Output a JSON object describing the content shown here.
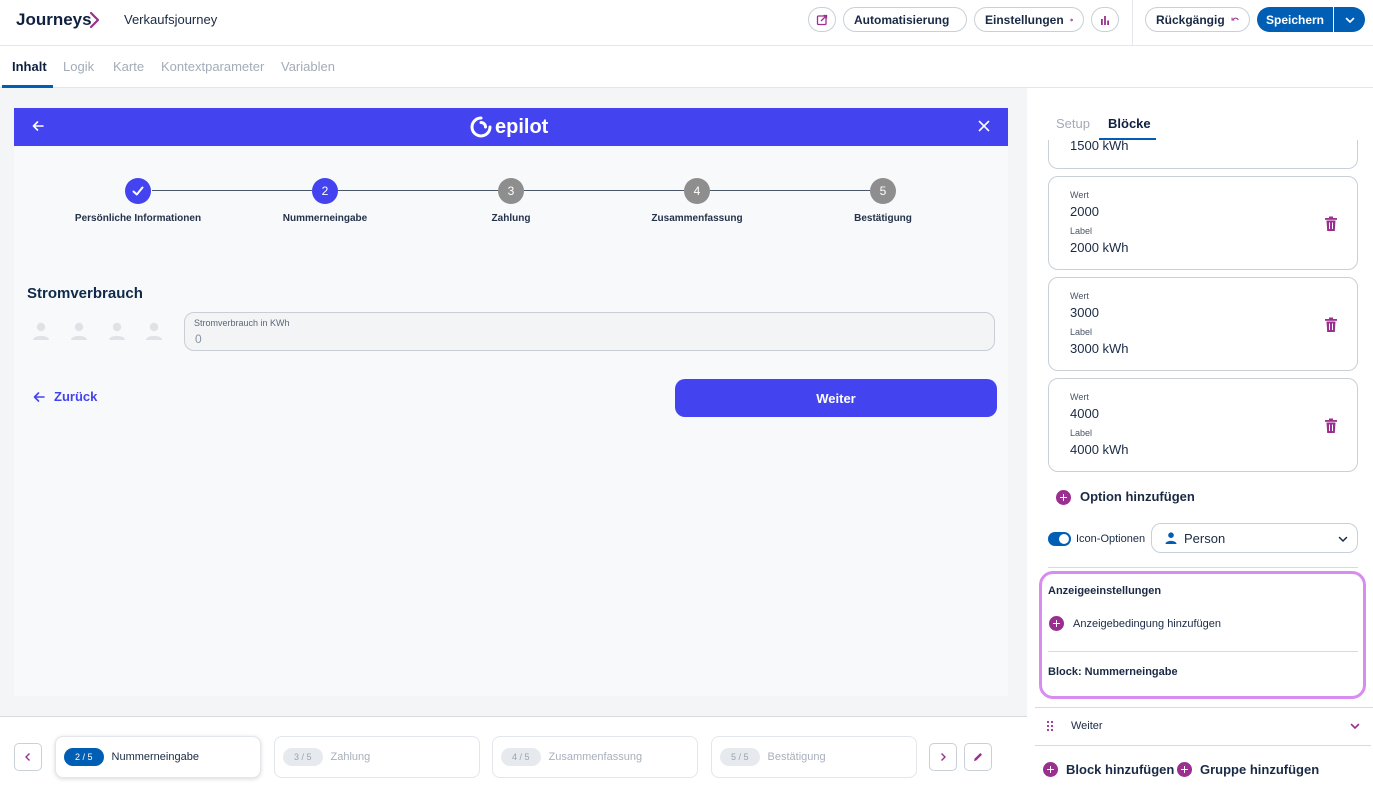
{
  "header": {
    "app_title": "Journeys",
    "journey_name": "Verkaufsjourney",
    "automation_label": "Automatisierung",
    "settings_label": "Einstellungen",
    "undo_label": "Rückgängig",
    "save_label": "Speichern"
  },
  "tabs": [
    "Inhalt",
    "Logik",
    "Karte",
    "Kontextparameter",
    "Variablen"
  ],
  "preview": {
    "logo_text": "epilot",
    "steps": [
      {
        "number": "",
        "label": "Persönliche Informationen",
        "state": "done"
      },
      {
        "number": "2",
        "label": "Nummerneingabe",
        "state": "active"
      },
      {
        "number": "3",
        "label": "Zahlung",
        "state": "upcoming"
      },
      {
        "number": "4",
        "label": "Zusammenfassung",
        "state": "upcoming"
      },
      {
        "number": "5",
        "label": "Bestätigung",
        "state": "upcoming"
      }
    ],
    "section_title": "Stromverbrauch",
    "field_label": "Stromverbrauch in KWh",
    "field_value": "0",
    "back_label": "Zurück",
    "next_label": "Weiter"
  },
  "bottom_steps": [
    {
      "badge": "2 / 5",
      "label": "Nummerneingabe",
      "active": true
    },
    {
      "badge": "3 / 5",
      "label": "Zahlung",
      "active": false
    },
    {
      "badge": "4 / 5",
      "label": "Zusammenfassung",
      "active": false
    },
    {
      "badge": "5 / 5",
      "label": "Bestätigung",
      "active": false
    }
  ],
  "right_panel": {
    "tabs": [
      "Setup",
      "Blöcke"
    ],
    "partial_option_label": "1500 kWh",
    "options": [
      {
        "value_caption": "Wert",
        "value": "2000",
        "label_caption": "Label",
        "label": "2000 kWh"
      },
      {
        "value_caption": "Wert",
        "value": "3000",
        "label_caption": "Label",
        "label": "3000 kWh"
      },
      {
        "value_caption": "Wert",
        "value": "4000",
        "label_caption": "Label",
        "label": "4000 kWh"
      }
    ],
    "add_option_label": "Option hinzufügen",
    "icon_options_label": "Icon-Optionen",
    "icon_select_value": "Person",
    "display_settings_title": "Anzeigeeinstellungen",
    "add_condition_label": "Anzeigebedingung hinzufügen",
    "block_label": "Block: Nummerneingabe",
    "weiter_row_label": "Weiter",
    "add_block_label": "Block hinzufügen",
    "add_group_label": "Gruppe hinzufügen"
  },
  "colors": {
    "primary": "#005eb4",
    "journey_accent": "#4343ef",
    "purple_accent": "#9b2f8f",
    "highlight": "#d98cf0",
    "step_inactive": "#8e8e8e"
  }
}
